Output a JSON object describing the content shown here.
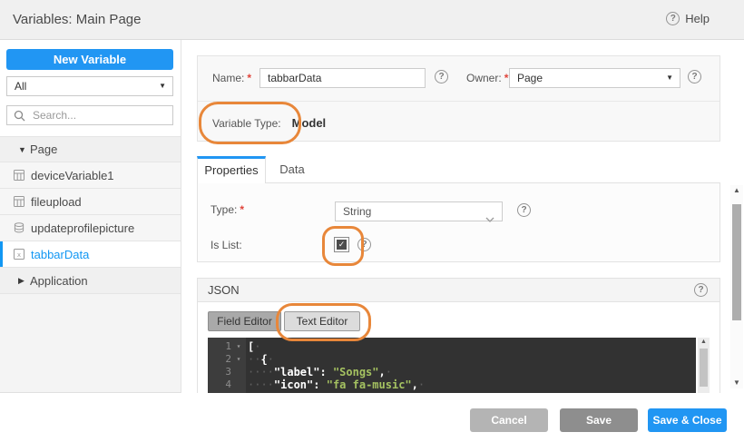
{
  "header": {
    "title": "Variables: Main Page",
    "help_label": "Help"
  },
  "ui": {
    "question_glyph": "?",
    "caret_down": "▼",
    "scroll_up": "▲",
    "scroll_down": "▼",
    "check": "✓",
    "required_mark": "*"
  },
  "sidebar": {
    "new_variable_label": "New Variable",
    "filter_value": "All",
    "search_placeholder": "Search...",
    "tree": [
      {
        "label": "Page",
        "arrow": "▼",
        "type": "group",
        "expanded": true
      },
      {
        "label": "deviceVariable1",
        "icon": "device-variable-icon"
      },
      {
        "label": "fileupload",
        "icon": "device-variable-icon"
      },
      {
        "label": "updateprofilepicture",
        "icon": "service-variable-icon"
      },
      {
        "label": "tabbarData",
        "icon": "model-variable-icon",
        "selected": true
      },
      {
        "label": "Application",
        "arrow": "▶",
        "type": "group",
        "expanded": false
      }
    ]
  },
  "form": {
    "name_label": "Name:",
    "name_value": "tabbarData",
    "owner_label": "Owner:",
    "owner_value": "Page",
    "variable_type_label": "Variable Type:",
    "variable_type_value": "Model"
  },
  "tabs": {
    "properties_label": "Properties",
    "data_label": "Data"
  },
  "properties": {
    "type_label": "Type:",
    "type_value": "String",
    "is_list_label": "Is List:",
    "is_list_checked": true
  },
  "json_section": {
    "title": "JSON",
    "field_editor_label": "Field Editor",
    "text_editor_label": "Text Editor",
    "code_lines": [
      {
        "num": "1",
        "fold": "▾",
        "indent": "",
        "key": "",
        "sep": "",
        "value": "",
        "punct": "[",
        "trail": "·"
      },
      {
        "num": "2",
        "fold": "▾",
        "indent": "··",
        "key": "",
        "sep": "",
        "value": "",
        "punct": "{",
        "trail": "·"
      },
      {
        "num": "3",
        "fold": "",
        "indent": "····",
        "key": "\"label\"",
        "sep": ": ",
        "value": "\"Songs\"",
        "punct": ",",
        "trail": "·"
      },
      {
        "num": "4",
        "fold": "",
        "indent": "····",
        "key": "\"icon\"",
        "sep": ": ",
        "value": "\"fa fa-music\"",
        "punct": ",",
        "trail": "·"
      }
    ]
  },
  "footer": {
    "cancel_label": "Cancel",
    "save_label": "Save",
    "save_close_label": "Save & Close"
  },
  "colors": {
    "accent_blue": "#2196f3",
    "selected_blue": "#1297f3",
    "annotation_orange": "#e8873a",
    "required_red": "#e0443a",
    "editor_bg": "#323232",
    "editor_string_green": "#a5c261"
  }
}
